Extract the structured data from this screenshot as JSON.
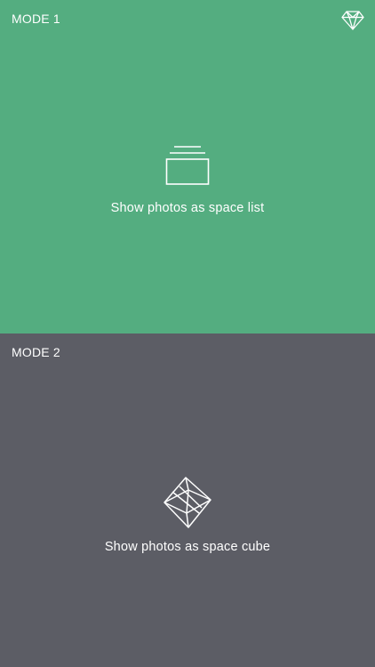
{
  "colors": {
    "mode1_background": "#54AD80",
    "mode2_background": "#5C5D65",
    "foreground": "#FFFFFF"
  },
  "header": {
    "premium_icon": "diamond-icon"
  },
  "modes": [
    {
      "label": "MODE 1",
      "icon": "stacked-list-icon",
      "caption": "Show photos as space list"
    },
    {
      "label": "MODE 2",
      "icon": "octahedron-cube-icon",
      "caption": "Show photos as space cube"
    }
  ]
}
